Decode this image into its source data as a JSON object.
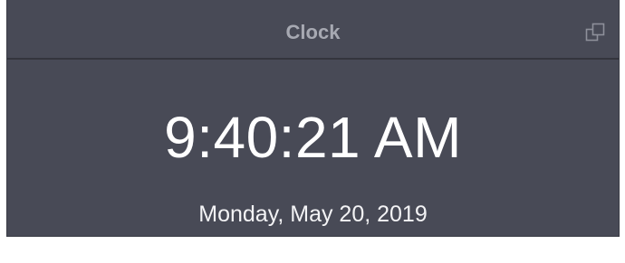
{
  "widget": {
    "title": "Clock",
    "popout_icon": "popout-window-icon"
  },
  "clock": {
    "time": "9:40:21 AM",
    "date": "Monday, May 20, 2019"
  },
  "colors": {
    "panel_bg": "#484a56",
    "header_divider": "#34353d",
    "title_text": "#a7a9b2",
    "time_text": "#ffffff"
  }
}
